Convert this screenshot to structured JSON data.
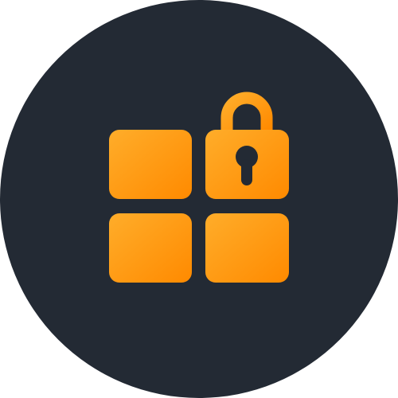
{
  "icon": {
    "name": "windows-lock-icon",
    "background_color": "#232a34",
    "gradient_start": "#ffad2a",
    "gradient_end": "#ff8a00",
    "keyhole_color": "#232a34"
  }
}
